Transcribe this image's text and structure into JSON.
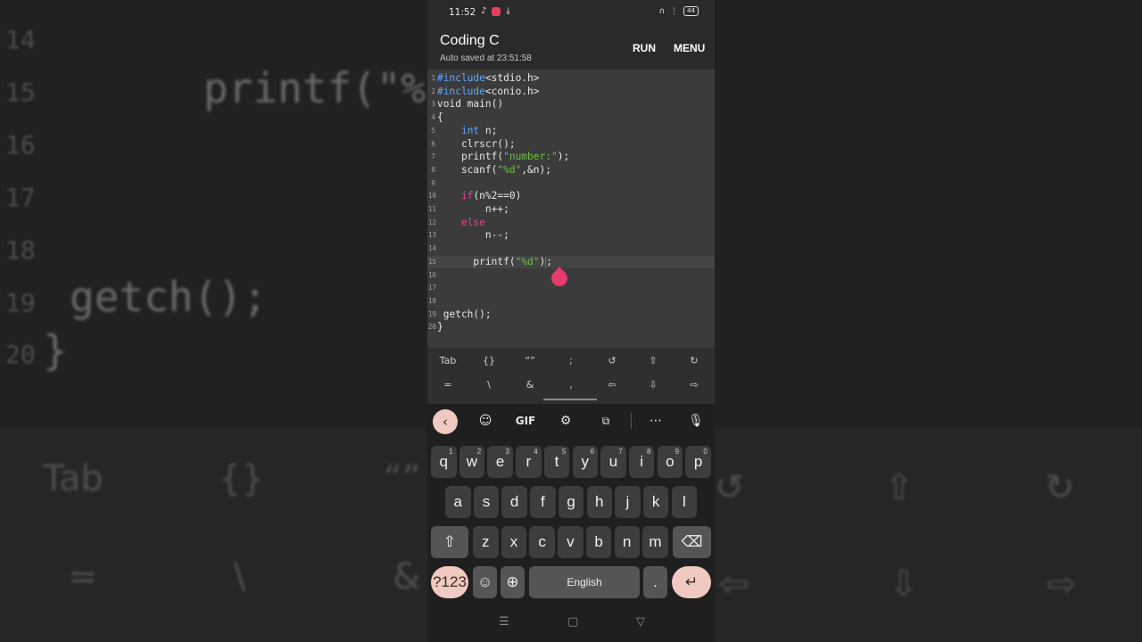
{
  "status_bar": {
    "time": "11:52",
    "left_icons": [
      "music-note",
      "instagram",
      "download"
    ],
    "right_icons": [
      "headphones",
      "vibrate",
      "battery"
    ],
    "battery": "44"
  },
  "app_bar": {
    "title": "Coding C",
    "subtitle": "Auto saved at 23:51:58",
    "run_label": "RUN",
    "menu_label": "MENU"
  },
  "editor": {
    "cursor_line": 15,
    "lines": [
      {
        "n": "1",
        "tokens": [
          {
            "t": "#include",
            "c": "pre"
          },
          {
            "t": "<stdio.h>",
            "c": "plain"
          }
        ]
      },
      {
        "n": "2",
        "tokens": [
          {
            "t": "#include",
            "c": "pre"
          },
          {
            "t": "<conio.h>",
            "c": "plain"
          }
        ]
      },
      {
        "n": "3",
        "tokens": [
          {
            "t": "void main()",
            "c": "plain"
          }
        ]
      },
      {
        "n": "4",
        "tokens": [
          {
            "t": "{",
            "c": "plain"
          }
        ]
      },
      {
        "n": "5",
        "tokens": [
          {
            "t": "    ",
            "c": "plain"
          },
          {
            "t": "int",
            "c": "kw"
          },
          {
            "t": " n;",
            "c": "plain"
          }
        ]
      },
      {
        "n": "6",
        "tokens": [
          {
            "t": "    clrscr();",
            "c": "plain"
          }
        ]
      },
      {
        "n": "7",
        "tokens": [
          {
            "t": "    printf(",
            "c": "plain"
          },
          {
            "t": "\"number:\"",
            "c": "str"
          },
          {
            "t": ");",
            "c": "plain"
          }
        ]
      },
      {
        "n": "8",
        "tokens": [
          {
            "t": "    scanf(",
            "c": "plain"
          },
          {
            "t": "\"%d\"",
            "c": "str"
          },
          {
            "t": ",&n);",
            "c": "plain"
          }
        ]
      },
      {
        "n": "9",
        "tokens": []
      },
      {
        "n": "10",
        "tokens": [
          {
            "t": "    ",
            "c": "plain"
          },
          {
            "t": "if",
            "c": "ctl"
          },
          {
            "t": "(n%2==0)",
            "c": "plain"
          }
        ]
      },
      {
        "n": "11",
        "tokens": [
          {
            "t": "        n++;",
            "c": "plain"
          }
        ]
      },
      {
        "n": "12",
        "tokens": [
          {
            "t": "    ",
            "c": "plain"
          },
          {
            "t": "else",
            "c": "ctl"
          }
        ]
      },
      {
        "n": "13",
        "tokens": [
          {
            "t": "        n--;",
            "c": "plain"
          }
        ]
      },
      {
        "n": "14",
        "tokens": []
      },
      {
        "n": "15",
        "tokens": [
          {
            "t": "      printf(",
            "c": "plain"
          },
          {
            "t": "\"%d\"",
            "c": "str"
          },
          {
            "t": ")",
            "c": "plain"
          },
          {
            "t": "|",
            "c": "caret"
          },
          {
            "t": ";",
            "c": "plain"
          }
        ]
      },
      {
        "n": "16",
        "tokens": []
      },
      {
        "n": "17",
        "tokens": []
      },
      {
        "n": "18",
        "tokens": []
      },
      {
        "n": "19",
        "tokens": [
          {
            "t": " getch();",
            "c": "plain"
          }
        ]
      },
      {
        "n": "20",
        "tokens": [
          {
            "t": "}",
            "c": "plain"
          }
        ]
      }
    ]
  },
  "symbol_bar": {
    "row1": [
      "Tab",
      "{}",
      "“”",
      ";",
      "↺",
      "⇧",
      "↻"
    ],
    "row2": [
      "=",
      "\\",
      "&",
      ",",
      "⇦",
      "⇩",
      "⇨"
    ]
  },
  "keyboard": {
    "toolbar": {
      "gif_label": "GIF",
      "icons": [
        "back-chevron",
        "sticker",
        "gif",
        "settings",
        "translate",
        "more",
        "microphone"
      ]
    },
    "row1": [
      {
        "k": "q",
        "h": "1"
      },
      {
        "k": "w",
        "h": "2"
      },
      {
        "k": "e",
        "h": "3"
      },
      {
        "k": "r",
        "h": "4"
      },
      {
        "k": "t",
        "h": "5"
      },
      {
        "k": "y",
        "h": "6"
      },
      {
        "k": "u",
        "h": "7"
      },
      {
        "k": "i",
        "h": "8"
      },
      {
        "k": "o",
        "h": "9"
      },
      {
        "k": "p",
        "h": "0"
      }
    ],
    "row2": [
      "a",
      "s",
      "d",
      "f",
      "g",
      "h",
      "j",
      "k",
      "l"
    ],
    "row3": [
      "z",
      "x",
      "c",
      "v",
      "b",
      "n",
      "m"
    ],
    "symbols_key": "?123",
    "emoji_key": "☺",
    "comma_key": ",",
    "space_label": "English",
    "period_key": "."
  },
  "background": {
    "line_numbers": [
      "14",
      "15",
      "16",
      "17",
      "18",
      "19",
      "20"
    ],
    "code_printf": "printf(\"%",
    "code_getch": "getch();",
    "code_brace": "}",
    "keys_row1": [
      "Tab",
      "{}",
      "“”",
      "↺",
      "⇧",
      "↻"
    ],
    "keys_row2": [
      "=",
      "\\",
      "&",
      "⇦",
      "⇩",
      "⇨"
    ]
  }
}
